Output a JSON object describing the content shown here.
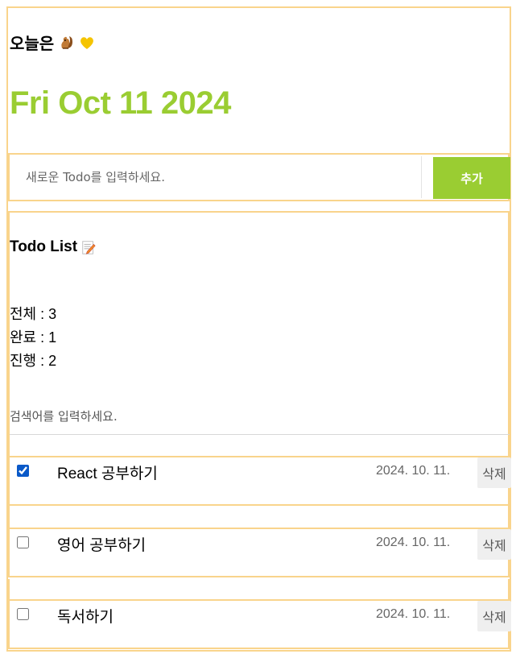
{
  "header": {
    "title": "오늘은",
    "date": "Fri Oct 11 2024"
  },
  "editor": {
    "placeholder": "새로운 Todo를 입력하세요.",
    "add_label": "추가"
  },
  "list": {
    "title": "Todo List",
    "stats": {
      "total": "전체 : 3",
      "done": "완료 : 1",
      "in_progress": "진행 : 2"
    },
    "search_placeholder": "검색어를 입력하세요."
  },
  "todos": [
    {
      "content": "React 공부하기",
      "date": "2024. 10. 11.",
      "delete_label": "삭제",
      "checked": true
    },
    {
      "content": "영어 공부하기",
      "date": "2024. 10. 11.",
      "delete_label": "삭제",
      "checked": false
    },
    {
      "content": "독서하기",
      "date": "2024. 10. 11.",
      "delete_label": "삭제",
      "checked": false
    }
  ],
  "colors": {
    "accent": "#9acd32",
    "border": "#f9d48c",
    "checkbox": "#0a59c8"
  },
  "icons": {
    "header_icons": [
      "squirrel-icon",
      "heart-icon"
    ],
    "list_icon": "memo-icon"
  }
}
